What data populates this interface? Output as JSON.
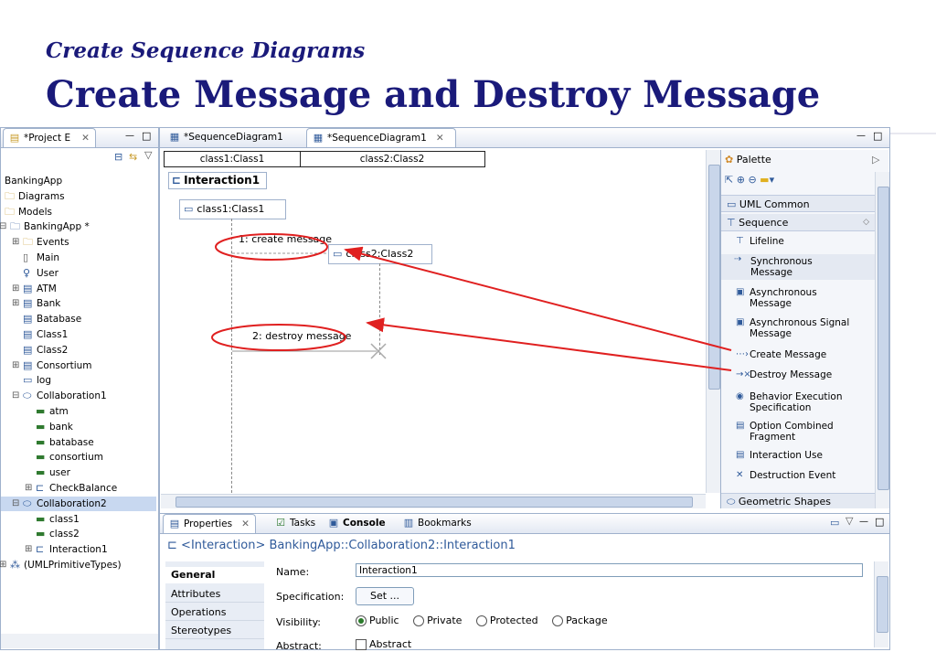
{
  "slide": {
    "subtitle": "Create Sequence Diagrams",
    "title": "Create Message and Destroy Message"
  },
  "project_explorer": {
    "tab_label": "*Project E",
    "tree": [
      {
        "label": "BankingApp",
        "icon": "none",
        "indent": 0
      },
      {
        "label": "Diagrams",
        "icon": "folder-icon",
        "indent": 0
      },
      {
        "label": "Models",
        "icon": "folder-icon",
        "indent": 0
      },
      {
        "label": "BankingApp *",
        "icon": "package-icon",
        "indent": 1,
        "expander": "−"
      },
      {
        "label": "Events",
        "icon": "folder-icon",
        "indent": 2,
        "expander": "+"
      },
      {
        "label": "Main",
        "icon": "file-icon",
        "indent": 2
      },
      {
        "label": "User",
        "icon": "actor-icon",
        "indent": 2
      },
      {
        "label": "ATM",
        "icon": "class-icon",
        "indent": 2,
        "expander": "+"
      },
      {
        "label": "Bank",
        "icon": "class-icon",
        "indent": 2,
        "expander": "+"
      },
      {
        "label": "Batabase",
        "icon": "class-icon",
        "indent": 2
      },
      {
        "label": "Class1",
        "icon": "class-icon",
        "indent": 2
      },
      {
        "label": "Class2",
        "icon": "class-icon",
        "indent": 2
      },
      {
        "label": "Consortium",
        "icon": "class-icon",
        "indent": 2,
        "expander": "+"
      },
      {
        "label": "log",
        "icon": "signal-icon",
        "indent": 2
      },
      {
        "label": "Collaboration1",
        "icon": "collaboration-icon",
        "indent": 2,
        "expander": "−"
      },
      {
        "label": "atm",
        "icon": "part-icon",
        "indent": 3
      },
      {
        "label": "bank",
        "icon": "part-icon",
        "indent": 3
      },
      {
        "label": "batabase",
        "icon": "part-icon",
        "indent": 3
      },
      {
        "label": "consortium",
        "icon": "part-icon",
        "indent": 3
      },
      {
        "label": "user",
        "icon": "part-icon",
        "indent": 3
      },
      {
        "label": "CheckBalance",
        "icon": "interaction-icon",
        "indent": 3,
        "expander": "+"
      },
      {
        "label": "Collaboration2",
        "icon": "collaboration-icon",
        "indent": 2,
        "expander": "−",
        "selected": true
      },
      {
        "label": "class1",
        "icon": "part-icon",
        "indent": 3
      },
      {
        "label": "class2",
        "icon": "part-icon",
        "indent": 3
      },
      {
        "label": "Interaction1",
        "icon": "interaction-icon",
        "indent": 3,
        "expander": "+"
      },
      {
        "label": "(UMLPrimitiveTypes)",
        "icon": "primitive-types-icon",
        "indent": 1,
        "expander": "+"
      }
    ]
  },
  "editor": {
    "tabs": [
      "*SequenceDiagram1",
      "*SequenceDiagram1"
    ],
    "header_cells": [
      "class1:Class1",
      "class2:Class2"
    ],
    "interaction_name": "Interaction1",
    "lifeline1": "class1:Class1",
    "lifeline2": "class2:Class2",
    "msg_create": "1: create message",
    "msg_destroy": "2: destroy message"
  },
  "palette": {
    "title": "Palette",
    "drawers": [
      "UML Common",
      "Sequence",
      "Geometric Shapes"
    ],
    "items": [
      {
        "label": "Lifeline",
        "icon": "lifeline-icon"
      },
      {
        "label": "Synchronous\nMessage",
        "icon": "sync-message-icon"
      },
      {
        "label": "Asynchronous\nMessage",
        "icon": "async-message-icon"
      },
      {
        "label": "Asynchronous Signal\nMessage",
        "icon": "async-signal-icon"
      },
      {
        "label": "Create Message",
        "icon": "create-message-icon"
      },
      {
        "label": "Destroy Message",
        "icon": "destroy-message-icon"
      },
      {
        "label": "Behavior Execution\nSpecification",
        "icon": "behavior-exec-icon"
      },
      {
        "label": "Option Combined\nFragment",
        "icon": "option-fragment-icon"
      },
      {
        "label": "Interaction Use",
        "icon": "interaction-use-icon"
      },
      {
        "label": "Destruction Event",
        "icon": "destruction-event-icon"
      }
    ]
  },
  "properties": {
    "tabs": [
      "Properties",
      "Tasks",
      "Console",
      "Bookmarks"
    ],
    "heading": "<Interaction> BankingApp::Collaboration2::Interaction1",
    "sections": [
      "General",
      "Attributes",
      "Operations",
      "Stereotypes"
    ],
    "name_label": "Name:",
    "name_value": "Interaction1",
    "spec_label": "Specification:",
    "spec_button": "Set ...",
    "visibility_label": "Visibility:",
    "visibility_options": [
      "Public",
      "Private",
      "Protected",
      "Package"
    ],
    "visibility_selected": "Public",
    "abstract_label": "Abstract:",
    "abstract_checkbox": "Abstract"
  },
  "colors": {
    "title": "#1a1a7a",
    "annotation_red": "#e02020",
    "frame_border": "#9fb1cc",
    "selection": "#c8d8f0"
  }
}
